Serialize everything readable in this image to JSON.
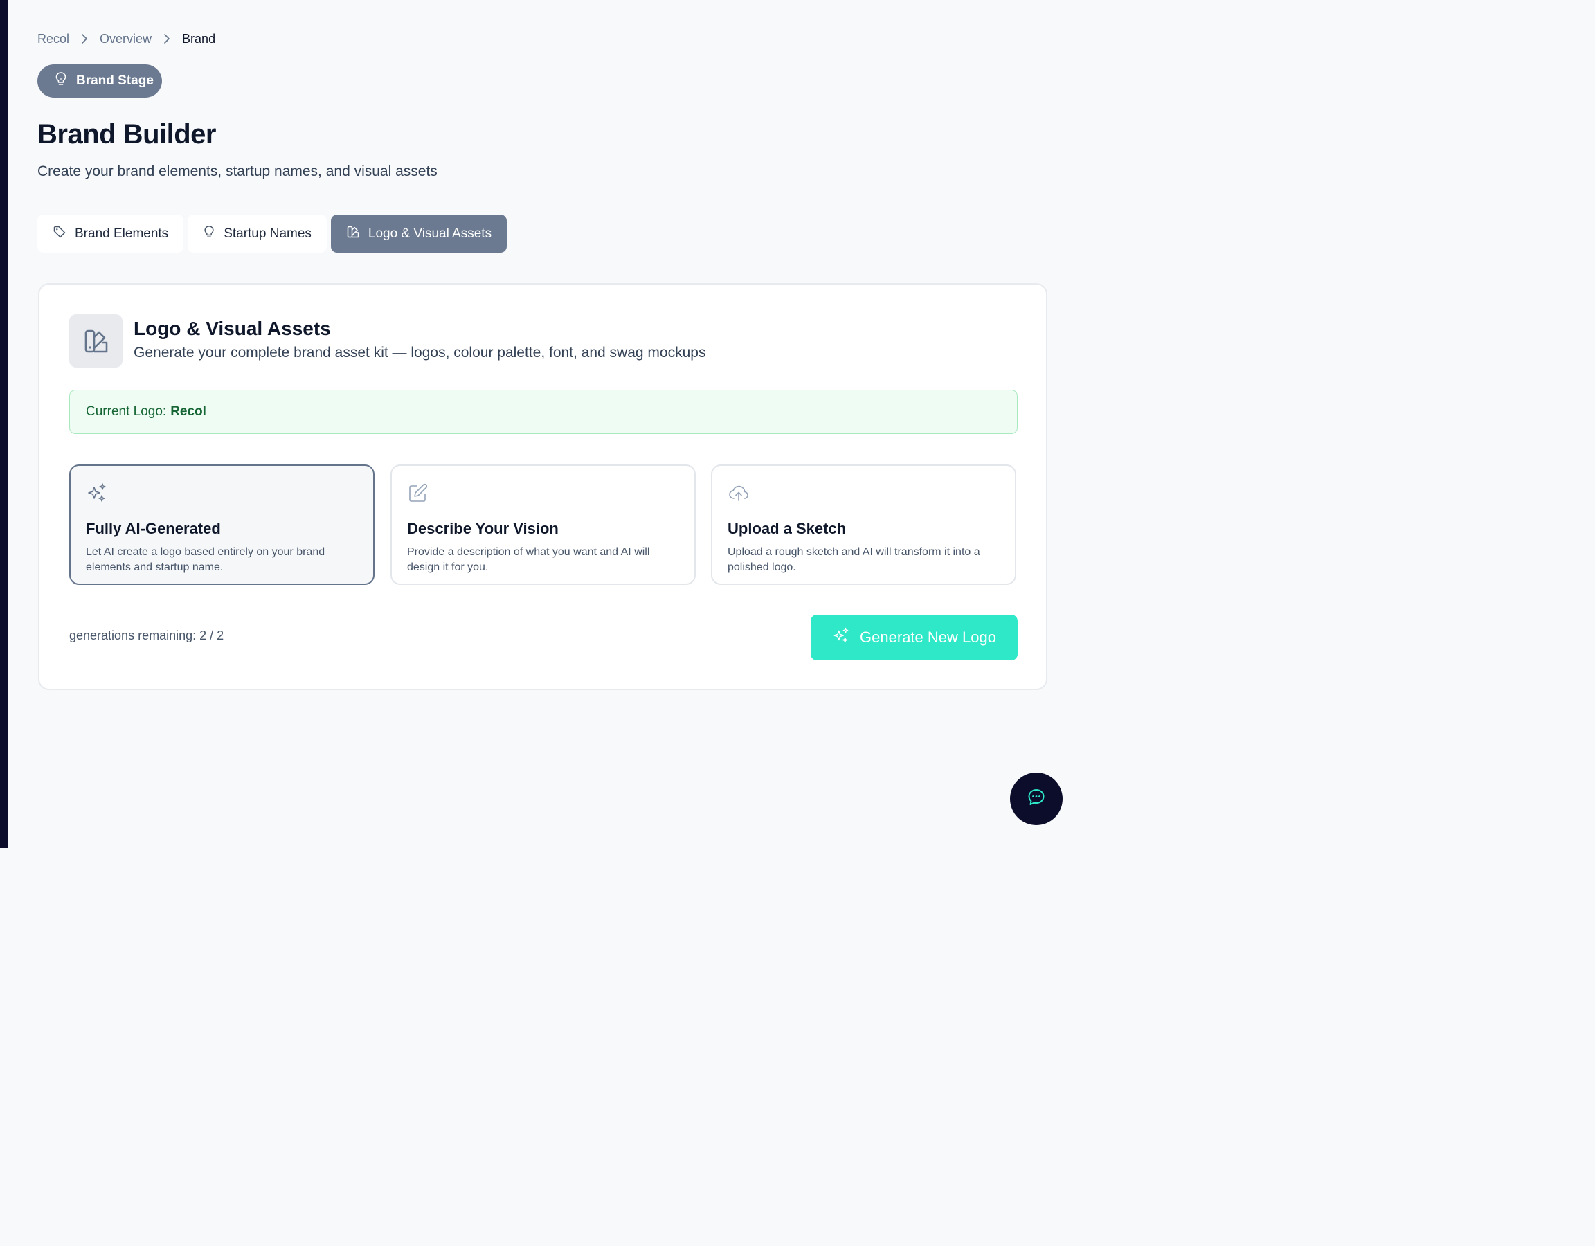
{
  "breadcrumb": {
    "items": [
      "Recol",
      "Overview",
      "Brand"
    ]
  },
  "stage": {
    "label": "Brand Stage",
    "icon": "lightbulb-icon"
  },
  "page": {
    "title": "Brand Builder",
    "subtitle": "Create your brand elements, startup names, and visual assets"
  },
  "tabs": [
    {
      "label": "Brand Elements",
      "icon": "tag-icon",
      "active": false
    },
    {
      "label": "Startup Names",
      "icon": "lightbulb-icon",
      "active": false
    },
    {
      "label": "Logo & Visual Assets",
      "icon": "swatch-book-icon",
      "active": true
    }
  ],
  "card": {
    "title": "Logo & Visual Assets",
    "subtitle": "Generate your complete brand asset kit — logos, colour palette, font, and swag mockups",
    "icon": "swatch-book-icon",
    "current_logo_label": "Current Logo:",
    "current_logo_value": "Recol",
    "options": [
      {
        "title": "Fully AI-Generated",
        "description": "Let AI create a logo based entirely on your brand elements and startup name.",
        "icon": "sparkles-icon",
        "selected": true
      },
      {
        "title": "Describe Your Vision",
        "description": "Provide a description of what you want and AI will design it for you.",
        "icon": "pencil-square-icon",
        "selected": false
      },
      {
        "title": "Upload a Sketch",
        "description": "Upload a rough sketch and AI will transform it into a polished logo.",
        "icon": "cloud-upload-icon",
        "selected": false
      }
    ],
    "generations_remaining": "generations remaining: 2 / 2",
    "generate_button_label": "Generate New Logo"
  },
  "colors": {
    "accent": "#2ee8c8",
    "active_tab": "#6b7a90",
    "rail": "#0b0d2a",
    "success_bg": "#effcf3",
    "success_text": "#166534"
  },
  "chat": {
    "icon": "chat-bubble-icon"
  }
}
